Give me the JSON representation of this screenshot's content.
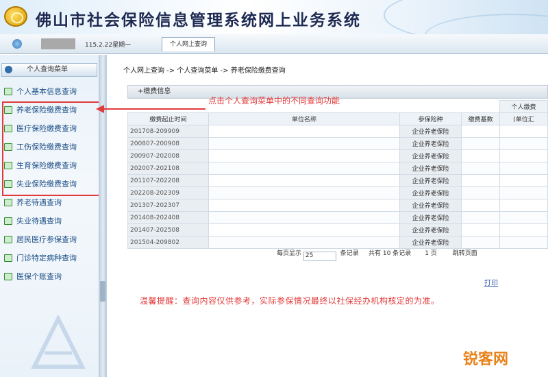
{
  "header": {
    "title": "佛山市社会保险信息管理系统网上业务系统"
  },
  "tabbar": {
    "date": "115.2.22星期一",
    "active_tab": "个人网上查询"
  },
  "sidebar": {
    "header": "个人查询菜单",
    "items": [
      {
        "label": "个人基本信息查询"
      },
      {
        "label": "养老保险缴费查询"
      },
      {
        "label": "医疗保险缴费查询"
      },
      {
        "label": "工伤保险缴费查询"
      },
      {
        "label": "生育保险缴费查询"
      },
      {
        "label": "失业保险缴费查询"
      },
      {
        "label": "养老待遇查询"
      },
      {
        "label": "失业待遇查询"
      },
      {
        "label": "居民医疗参保查询"
      },
      {
        "label": "门诊特定病种查询"
      },
      {
        "label": "医保个账查询"
      }
    ]
  },
  "main": {
    "breadcrumb": "个人网上查询 -> 个人查询菜单 -> 养老保险缴费查询",
    "panel_title": "+缴费信息",
    "annotation": "点击个人查询菜单中的不同查询功能",
    "table": {
      "headers": [
        "缴费起止时间",
        "单位名称",
        "参保险种",
        "缴费基数",
        "个人缴费",
        "(单位汇"
      ],
      "rows": [
        {
          "period": "201708-209909",
          "insurance": "企业养老保险"
        },
        {
          "period": "200807-200908",
          "insurance": "企业养老保险"
        },
        {
          "period": "200907-202008",
          "insurance": "企业养老保险"
        },
        {
          "period": "202007-202108",
          "insurance": "企业养老保险"
        },
        {
          "period": "201107-202208",
          "insurance": "企业养老保险"
        },
        {
          "period": "202208-202309",
          "insurance": "企业养老保险"
        },
        {
          "period": "201307-202307",
          "insurance": "企业养老保险"
        },
        {
          "period": "201408-202408",
          "insurance": "企业养老保险"
        },
        {
          "period": "201407-202508",
          "insurance": "企业养老保险"
        },
        {
          "period": "201504-209802",
          "insurance": "企业养老保险"
        }
      ]
    },
    "pager": {
      "page_size_label": "每页显示",
      "page_size": "25",
      "records_label": "条记录",
      "total_label": "共有",
      "total": "10",
      "total_unit": "条记录",
      "page": "1",
      "page_unit": "页",
      "goto_label": "跳转页面"
    },
    "print_label": "打印",
    "notice": "温馨提醒：查询内容仅供参考，实际参保情况最终以社保经办机构核定的为准。"
  },
  "watermark": {
    "text": "锐客网"
  },
  "colors": {
    "accent_red": "#e23a3a",
    "link_blue": "#2b5aa8",
    "sidebar_text": "#1d4f86"
  }
}
